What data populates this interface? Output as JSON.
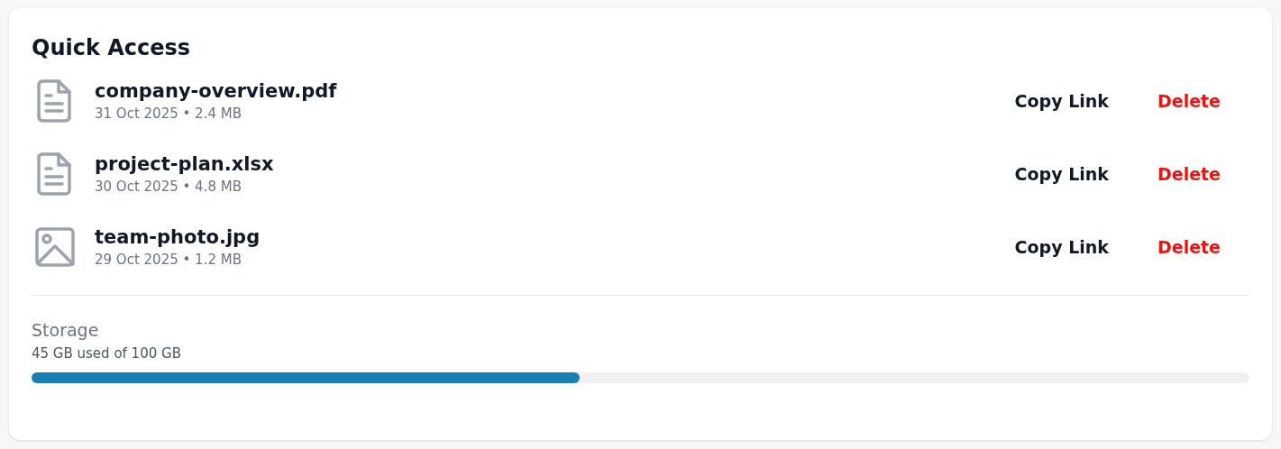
{
  "title": "Quick Access",
  "files": [
    {
      "kind": "document",
      "name": "company-overview.pdf",
      "meta": "31 Oct 2025 • 2.4 MB",
      "actions": [
        "Copy Link",
        "Delete"
      ]
    },
    {
      "kind": "document",
      "name": "project-plan.xlsx",
      "meta": "30 Oct 2025 • 4.8 MB",
      "actions": [
        "Copy Link",
        "Delete"
      ]
    },
    {
      "kind": "image",
      "name": "team-photo.jpg",
      "meta": "29 Oct 2025 • 1.2 MB",
      "actions": [
        "Copy Link",
        "Delete"
      ]
    }
  ],
  "storage": {
    "label": "Storage",
    "reading": "45 GB used of 100 GB",
    "level": 0.45
  }
}
